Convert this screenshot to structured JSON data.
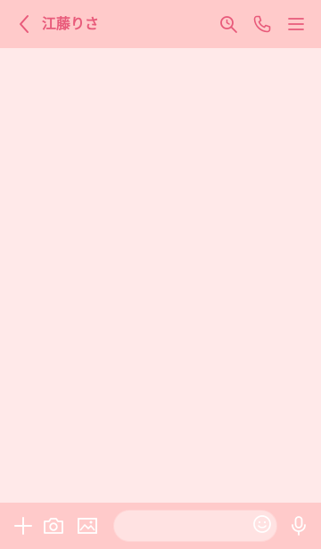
{
  "header": {
    "title": "江藤りさ",
    "back_icon": "chevron-left-icon",
    "search_icon": "search-icon",
    "call_icon": "phone-icon",
    "menu_icon": "menu-icon"
  },
  "footer": {
    "add_icon": "plus-icon",
    "camera_icon": "camera-icon",
    "image_icon": "image-icon",
    "message_placeholder": "",
    "emoji_icon": "smiley-icon",
    "mic_icon": "microphone-icon"
  },
  "colors": {
    "header_bg": "#ffcaca",
    "chat_bg": "#ffe9e9",
    "accent": "#e85a7a",
    "footer_icon": "#ffffff"
  }
}
